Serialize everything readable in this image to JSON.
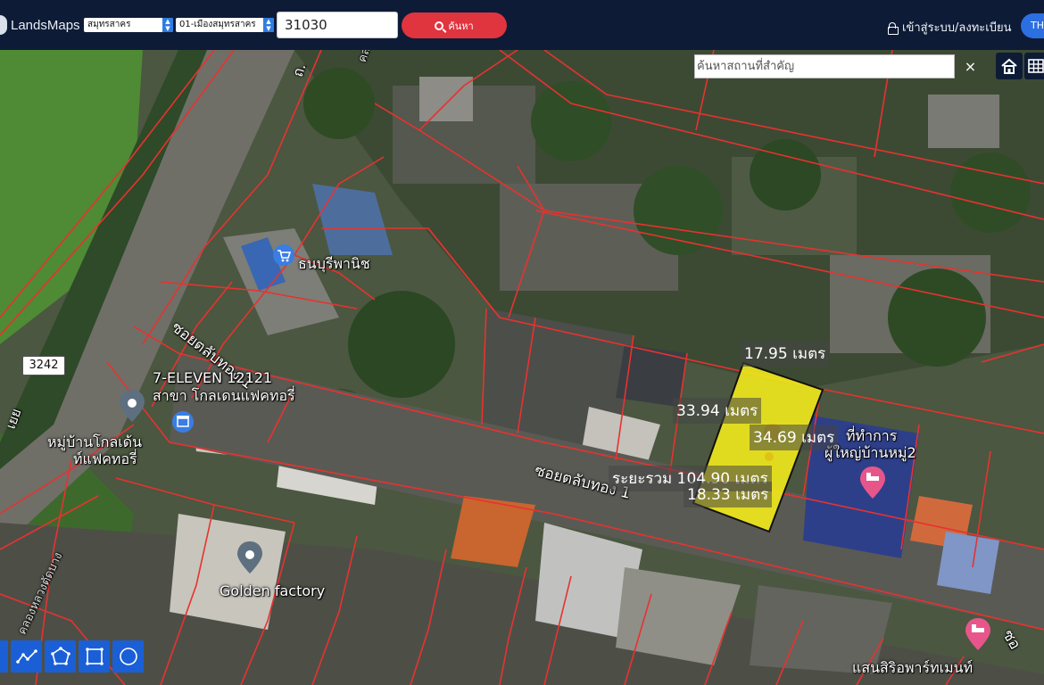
{
  "header": {
    "logo_text": "LandsMaps",
    "province": "สมุทรสาคร",
    "district": "01-เมืองสมุทรสาคร",
    "parcel_value": "31030",
    "search_label": "ค้นหา",
    "login_label": "เข้าสู่ระบบ/ลงทะเบียน",
    "lang_label": "TH"
  },
  "map": {
    "place_search_placeholder": "ค้นหาสถานที่สำคัญ",
    "close_label": "×",
    "route_number": "3242",
    "road_labels": {
      "soi_1": "ซอยตลับทอง 1",
      "soi_2": "ซอยตลับทอง 1",
      "canal_1": "คลองหลวงเจ",
      "canal_2": "คลองหลวงตัดบาง",
      "th": "ถ.",
      "edge_top": "ซอ",
      "edge_left": "เยย"
    },
    "places": [
      {
        "name": "ธนบุรีพานิช",
        "icon": "shopping-cart-icon"
      },
      {
        "name": "7-ELEVEN 12121",
        "icon": null
      },
      {
        "name": "สาขา โกลเดนแฟคทอรี่",
        "icon": null
      },
      {
        "name": "หมู่บ้านโกลเด้น",
        "icon": "map-pin-icon"
      },
      {
        "name": "ท์แฟคทอรี่",
        "icon": null
      },
      {
        "name": "Golden factory",
        "icon": "map-pin-icon"
      },
      {
        "name": "ที่ทำการ",
        "icon": null
      },
      {
        "name": "ผู้ใหญ่บ้านหมู่2",
        "icon": "hotel-icon"
      },
      {
        "name": "แสนสิริอพาร์ทเมนท์",
        "icon": "hotel-icon"
      }
    ],
    "measurements": {
      "top": "17.95 เมตร",
      "left": "33.94 เมตร",
      "right": "34.69 เมตร",
      "total": "ระยะรวม 104.90 เมตร",
      "bottom": "18.33 เมตร"
    },
    "colors": {
      "parcel_line": "#e8322f",
      "highlight_fill": "#f2ea1c",
      "nav_bg": "#0d1b36",
      "search_btn": "#e0343f",
      "tool_btn": "#1a5fd6"
    }
  }
}
